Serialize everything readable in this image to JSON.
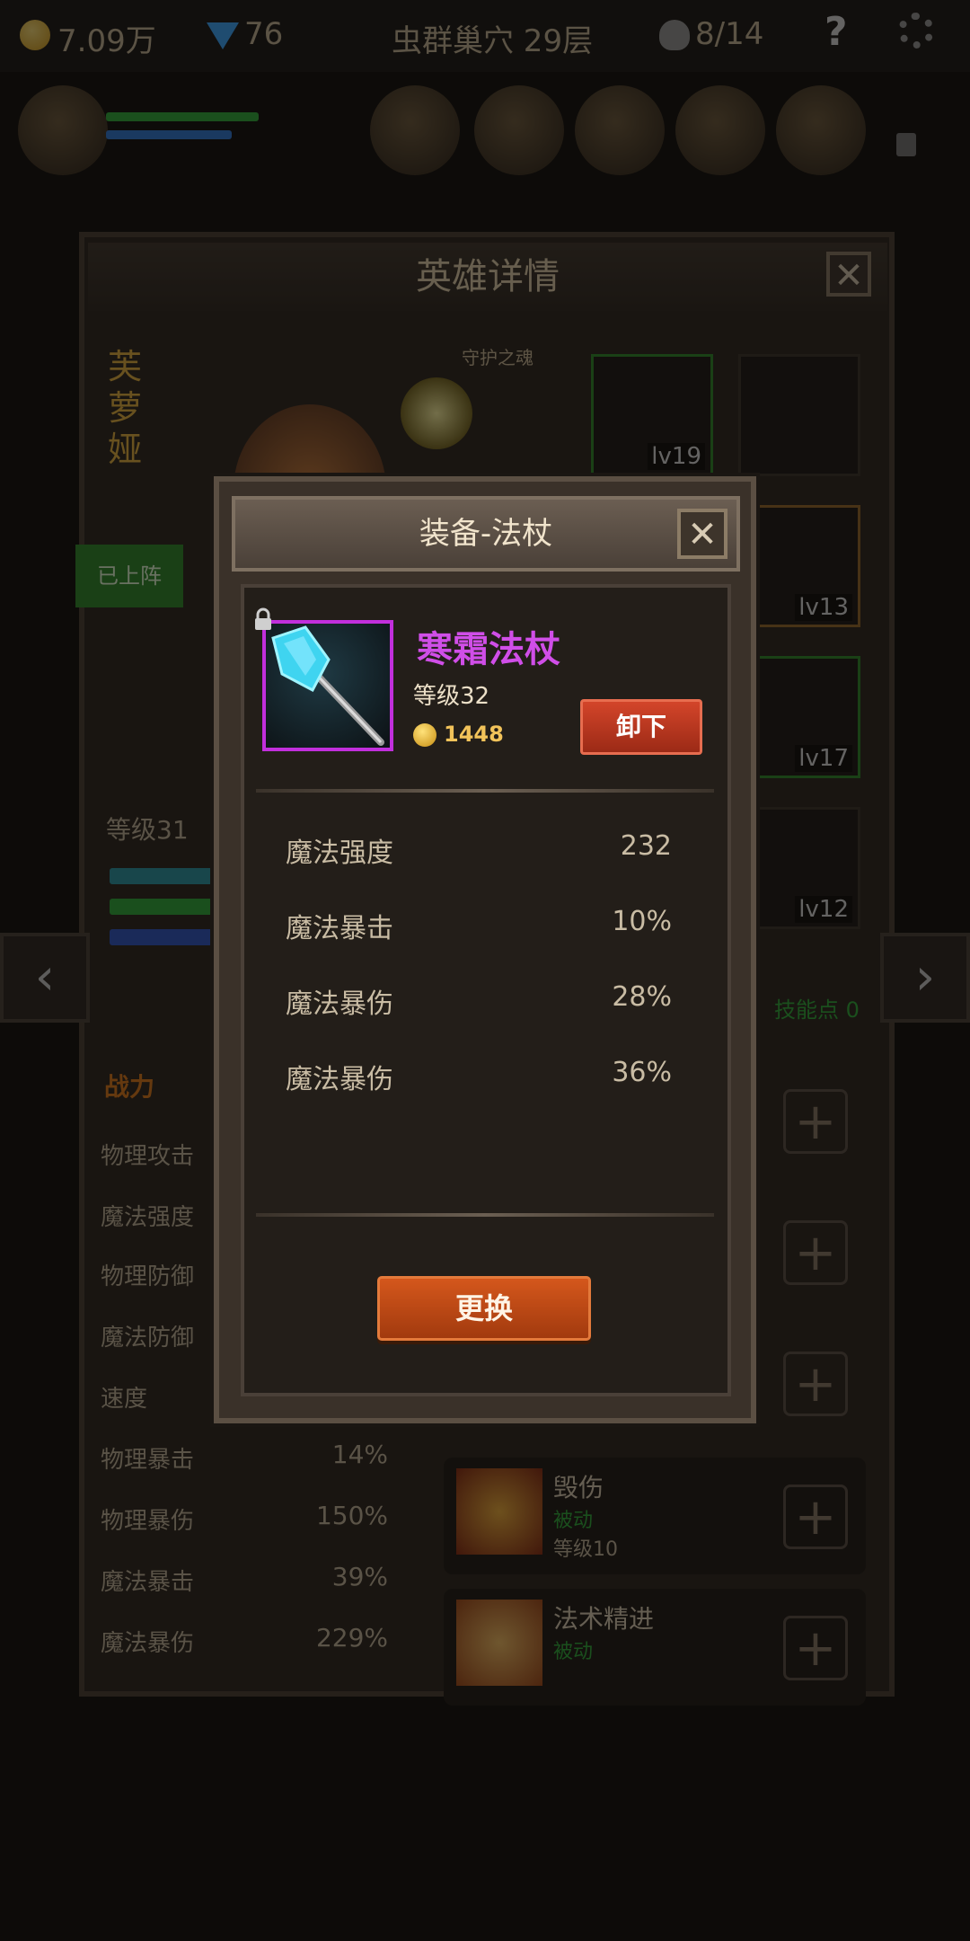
{
  "topbar": {
    "gold": "7.09万",
    "gems": "76",
    "stage": "虫群巢穴 29层",
    "keys": "8/14",
    "help": "?"
  },
  "hero_panel": {
    "title": "英雄详情",
    "close": "✕",
    "hero_name": "芙萝娅",
    "pet_label": "守护之魂",
    "deployed_badge": "已上阵",
    "hero_level": "等级31",
    "equipment_levels": [
      "lv19",
      "lv13",
      "lv17",
      "lv12"
    ],
    "skill_points": "技能点 0",
    "stats_header": "战力",
    "stats": [
      {
        "label": "物理攻击",
        "value": ""
      },
      {
        "label": "魔法强度",
        "value": ""
      },
      {
        "label": "物理防御",
        "value": ""
      },
      {
        "label": "魔法防御",
        "value": ""
      },
      {
        "label": "速度",
        "value": ""
      },
      {
        "label": "物理暴击",
        "value": "14%"
      },
      {
        "label": "物理暴伤",
        "value": "150%"
      },
      {
        "label": "魔法暴击",
        "value": "39%"
      },
      {
        "label": "魔法暴伤",
        "value": "229%"
      }
    ],
    "skills": [
      {
        "name": "毁伤",
        "type": "被动",
        "level": "等级10"
      },
      {
        "name": "法术精进",
        "type": "被动",
        "level": ""
      }
    ]
  },
  "modal": {
    "title": "装备-法杖",
    "close": "✕",
    "item_name": "寒霜法杖",
    "item_level": "等级32",
    "item_price": "1448",
    "unequip_label": "卸下",
    "stats": [
      {
        "label": "魔法强度",
        "value": "232"
      },
      {
        "label": "魔法暴击",
        "value": "10%"
      },
      {
        "label": "魔法暴伤",
        "value": "28%"
      },
      {
        "label": "魔法暴伤",
        "value": "36%"
      }
    ],
    "replace_label": "更换"
  },
  "colors": {
    "rarity_purple": "#c12fdc",
    "item_name_color": "#d04ee8",
    "price_gold": "#f2c35a",
    "button_red": "#c23a22",
    "button_orange": "#c44d16",
    "hero_name_gold": "#e7b23f",
    "passive_green": "#2fae3a"
  },
  "icons": {
    "gold": "gold-coin-icon",
    "gem": "gem-icon",
    "keys": "skull-icon",
    "help": "help-icon",
    "settings": "gear-icon",
    "lock": "lock-icon",
    "item": "frost-staff-icon",
    "left_nav": "chevron-left-icon",
    "right_nav": "chevron-right-icon"
  }
}
